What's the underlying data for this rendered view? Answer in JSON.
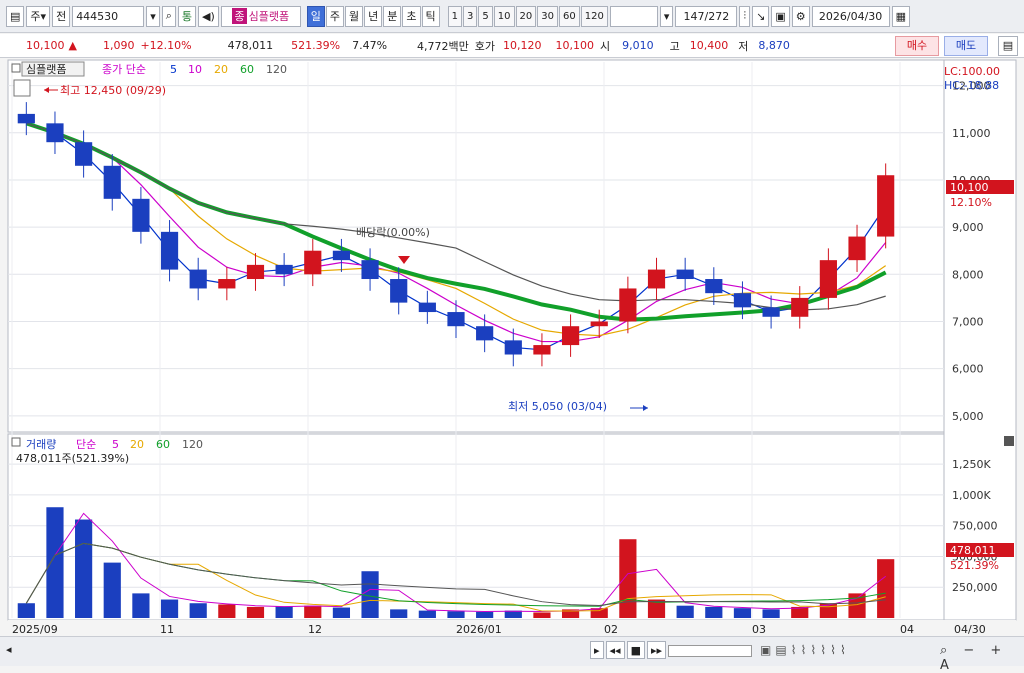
{
  "toolbar": {
    "market": "주",
    "type": "전",
    "code": "444530",
    "group": "통",
    "name": "심플랫폼",
    "periods": [
      "일",
      "주",
      "월",
      "년",
      "분",
      "초",
      "틱"
    ],
    "minutes": [
      "1",
      "3",
      "5",
      "10",
      "20",
      "30",
      "60",
      "120"
    ],
    "count": "147",
    "total": "272",
    "date": "2026/04/30",
    "zoom_label": "종"
  },
  "quote": {
    "price": "10,100",
    "arrow": "▲",
    "change": "1,090",
    "change_pct": "+12.10%",
    "volume": "478,011",
    "vol_pct": "521.39%",
    "turnover": "7.47%",
    "amount": "4,772백만",
    "bid_label": "호가",
    "bid1": "10,120",
    "bid2": "10,100",
    "open_label": "시",
    "open": "9,010",
    "high_label": "고",
    "high": "10,400",
    "low_label": "저",
    "low": "8,870",
    "buy_label": "매수",
    "sell_label": "매도"
  },
  "price_panel": {
    "legend_name": "심플랫폼",
    "legend_title": "종가 단순",
    "ma_periods": [
      "5",
      "10",
      "20",
      "60",
      "120"
    ],
    "ma_colors": [
      "#0033cc",
      "#cc00cc",
      "#e6a800",
      "#11a02a",
      "#555555"
    ],
    "lc": "LC:100.00",
    "hc": "HC:-18.88",
    "high_note": "최고 12,450 (09/29)",
    "low_note": "최저 5,050 (03/04)",
    "dividend_note": "배당락(0.00%)",
    "last_price_label": "10,100",
    "last_pct_label": "12.10%",
    "y_ticks": [
      "12,000",
      "11,000",
      "10,000",
      "9,000",
      "8,000",
      "7,000",
      "6,000",
      "5,000"
    ]
  },
  "volume_panel": {
    "legend_title": "거래량",
    "legend_sub": "단순",
    "ma_periods": [
      "5",
      "20",
      "60",
      "120"
    ],
    "vol_note": "478,011주(521.39%)",
    "last_vol_label": "478,011",
    "last_pct_label": "521.39%",
    "y_ticks": [
      "1,250K",
      "1,000K",
      "750,000",
      "500,000",
      "250,000"
    ]
  },
  "x_axis": {
    "labels": [
      "2025/09",
      "11",
      "12",
      "2026/01",
      "02",
      "03",
      "04"
    ],
    "right_label": "04/30"
  },
  "chart_data": {
    "type": "candlestick",
    "title": "심플랫폼",
    "xlabel": "",
    "ylabel": "",
    "ylim": [
      4700,
      12500
    ],
    "volume_ylim": [
      0,
      1300000
    ],
    "x": [
      "2025/09",
      "11",
      "12",
      "2026/01",
      "02",
      "03",
      "04"
    ],
    "series": [
      {
        "name": "종가",
        "values": [
          11200,
          10800,
          10300,
          9600,
          8900,
          8100,
          7700,
          7900,
          8200,
          8000,
          8500,
          8300,
          7900,
          7400,
          7200,
          6900,
          6600,
          6300,
          6500,
          6900,
          7000,
          7700,
          8100,
          7900,
          7600,
          7300,
          7100,
          7500,
          8300,
          8800,
          10100
        ]
      },
      {
        "name": "거래량",
        "values": [
          120000,
          900000,
          800000,
          450000,
          200000,
          150000,
          120000,
          110000,
          90000,
          95000,
          100000,
          85000,
          380000,
          70000,
          60000,
          55000,
          50000,
          60000,
          45000,
          70000,
          80000,
          640000,
          150000,
          100000,
          90000,
          80000,
          70000,
          90000,
          120000,
          200000,
          478011
        ]
      }
    ]
  }
}
